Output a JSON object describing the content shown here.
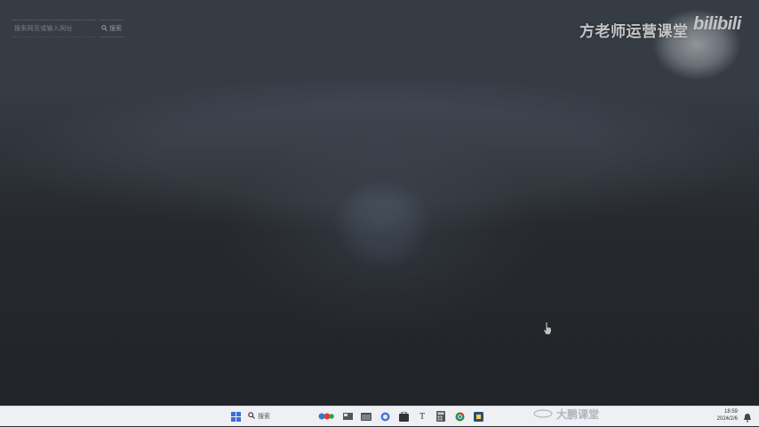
{
  "desktop": {
    "search_widget": {
      "placeholder": "搜索网页或输入网址",
      "button_label": "搜索"
    },
    "watermark": "方老师运营课堂",
    "platform_logo": "bilibili"
  },
  "taskbar": {
    "search_label": "搜索",
    "icons": [
      "start-icon",
      "search-icon",
      "widgets-icon",
      "file-explorer-icon",
      "browser-icon",
      "store-icon",
      "typora-icon",
      "calculator-icon",
      "chrome-icon",
      "app-icon"
    ],
    "logo_text": "大鹏课堂",
    "clock": {
      "time": "18:59",
      "date": "2024/2/6"
    }
  }
}
